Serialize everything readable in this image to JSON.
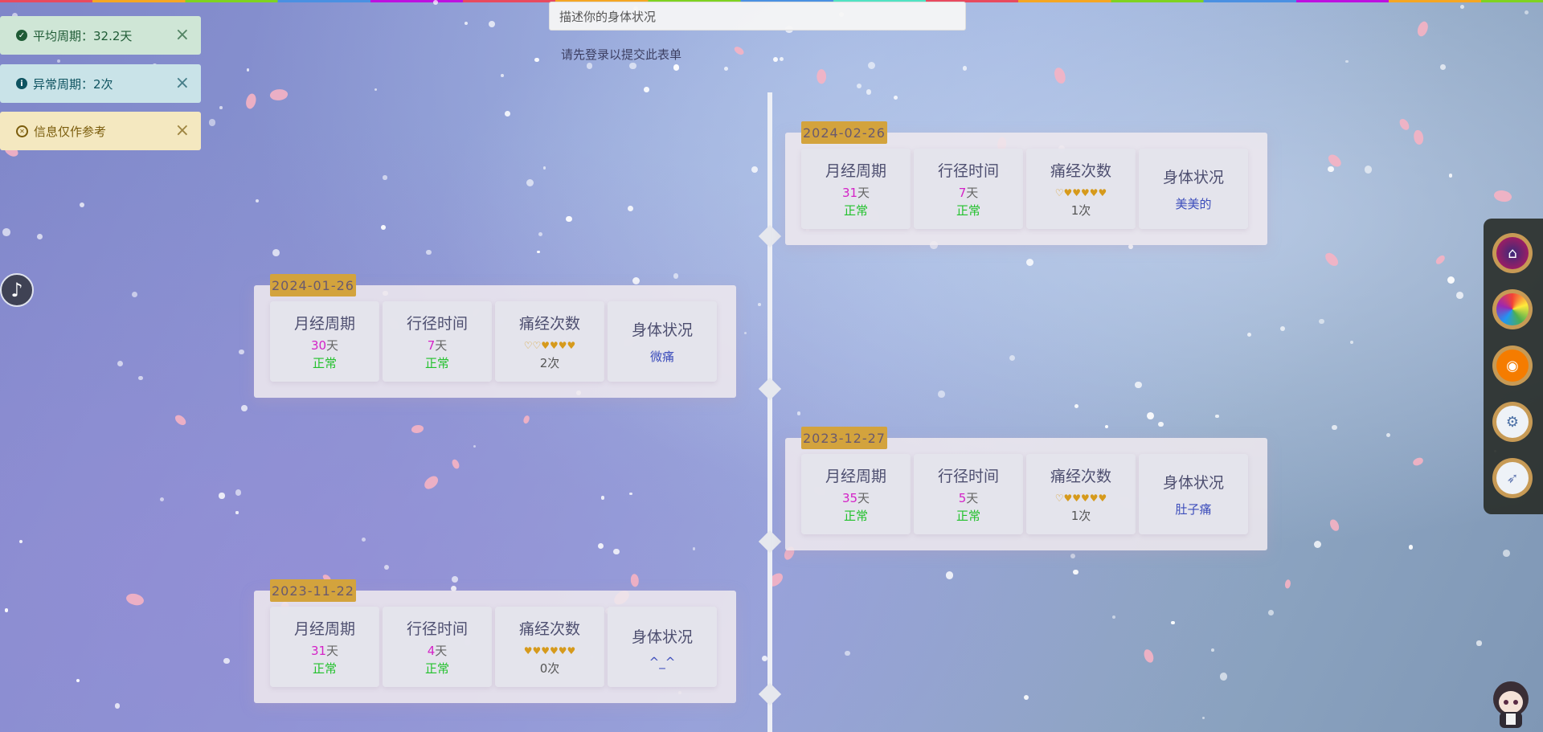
{
  "form": {
    "placeholder": "描述你的身体状况",
    "login_note": "请先登录以提交此表单"
  },
  "toasts": [
    {
      "text": "平均周期：32.2天",
      "icon": "check-icon",
      "type": "success"
    },
    {
      "text": "异常周期：2次",
      "icon": "info-icon",
      "type": "info"
    },
    {
      "text": "信息仅作参考",
      "icon": "lifebuoy-icon",
      "type": "warning"
    }
  ],
  "music_icon": "♪",
  "labels": {
    "cycle": "月经周期",
    "duration": "行径时间",
    "pain": "痛经次数",
    "body": "身体状况",
    "day_unit": "天",
    "times_unit": "次"
  },
  "records": [
    {
      "date": "2024-02-26",
      "cycle": "31",
      "cycle_status": "正常",
      "duration": "7",
      "duration_status": "正常",
      "hearts": "♡♥♥♥♥♥",
      "pain_count": "1",
      "body": "美美的"
    },
    {
      "date": "2024-01-26",
      "cycle": "30",
      "cycle_status": "正常",
      "duration": "7",
      "duration_status": "正常",
      "hearts": "♡♡♥♥♥♥",
      "pain_count": "2",
      "body": "微痛"
    },
    {
      "date": "2023-12-27",
      "cycle": "35",
      "cycle_status": "正常",
      "duration": "5",
      "duration_status": "正常",
      "hearts": "♡♥♥♥♥♥",
      "pain_count": "1",
      "body": "肚子痛"
    },
    {
      "date": "2023-11-22",
      "cycle": "31",
      "cycle_status": "正常",
      "duration": "4",
      "duration_status": "正常",
      "hearts": "♥♥♥♥♥♥",
      "pain_count": "0",
      "body": "^_^"
    }
  ],
  "dock_icons": [
    "home-icon",
    "color-wheel-icon",
    "camera-icon",
    "settings-icon",
    "rocket-icon"
  ],
  "colors": {
    "date_badge": "#d3a33d",
    "ok_text": "#22c12c",
    "number_text": "#d422c7",
    "hearts": "#d69a1c"
  }
}
